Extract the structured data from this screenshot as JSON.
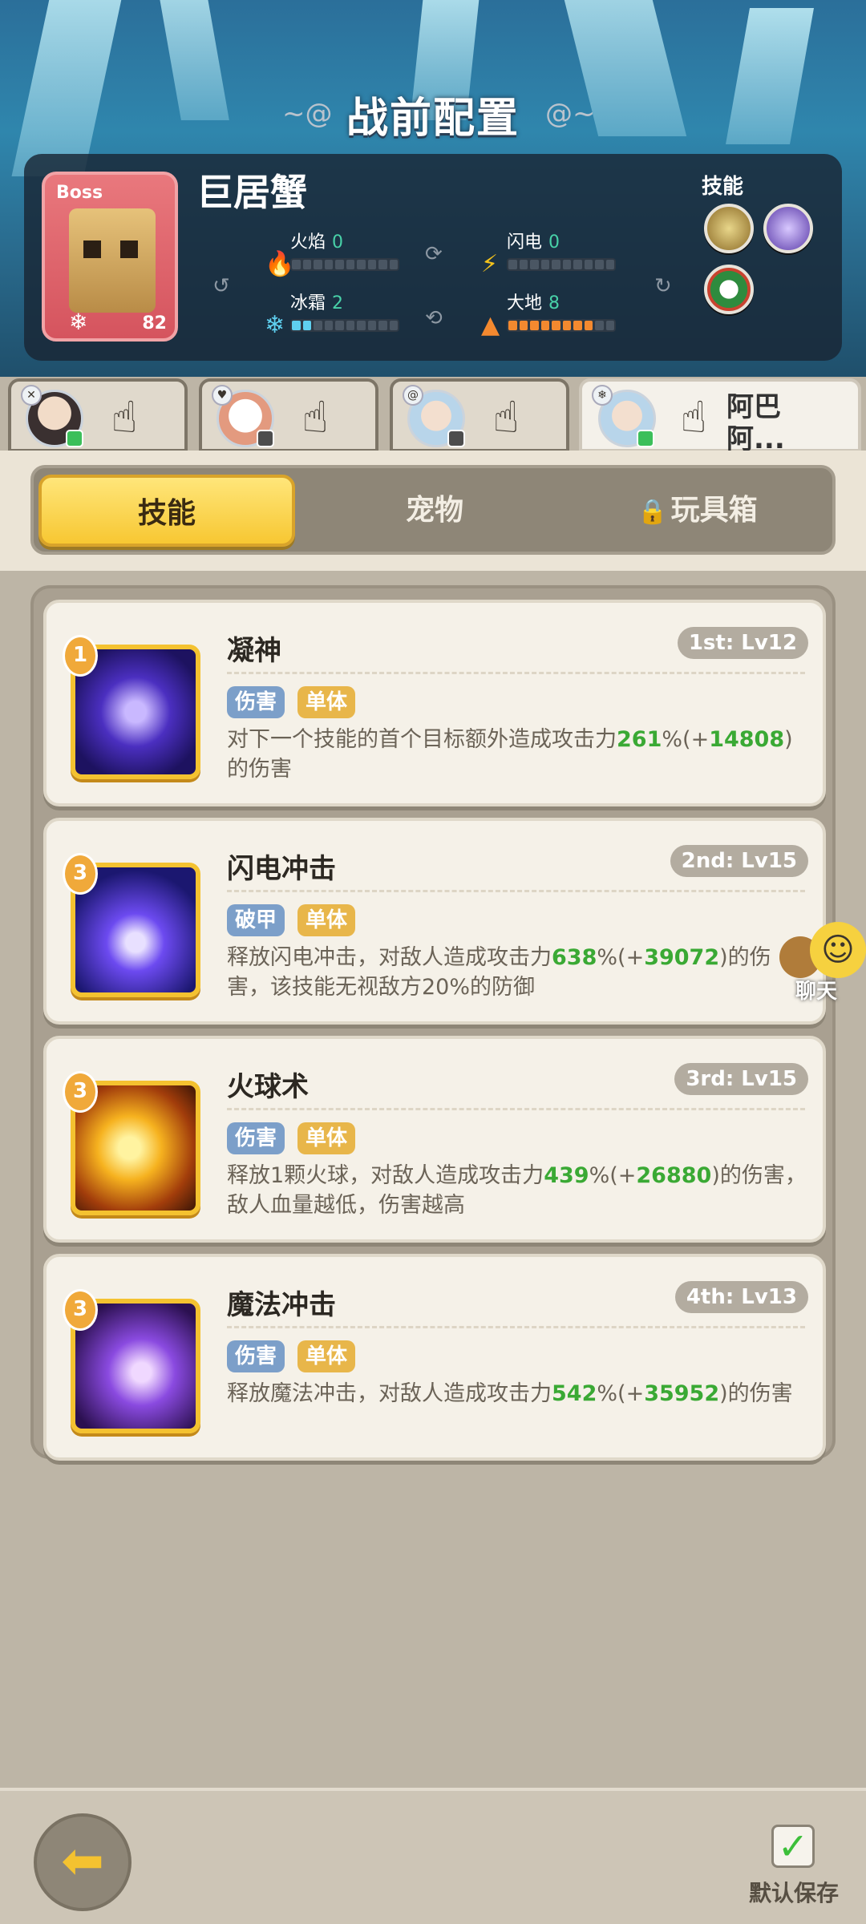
{
  "title": "战前配置",
  "boss": {
    "tag": "Boss",
    "name": "巨居蟹",
    "level": "82",
    "elements": [
      {
        "label": "火焰",
        "value": "0",
        "level": 0,
        "icon": "fire-icon",
        "color": "#e8432f"
      },
      {
        "label": "闪电",
        "value": "0",
        "level": 0,
        "icon": "lightning-icon",
        "color": "#f4c21c"
      },
      {
        "label": "冰霜",
        "value": "2",
        "level": 2,
        "icon": "snowflake-icon",
        "color": "#5fd0f0"
      },
      {
        "label": "大地",
        "value": "8",
        "level": 8,
        "icon": "mountain-icon",
        "color": "#f4892f"
      }
    ],
    "skills_label": "技能"
  },
  "team": [
    {
      "icon": "hero-avatar-dark-hair",
      "status": "green"
    },
    {
      "icon": "pet-avatar-white-bear",
      "status": "dark"
    },
    {
      "icon": "hero-avatar-blue-hair",
      "status": "dark"
    },
    {
      "icon": "hero-avatar-blue-hair-selected",
      "status": "green",
      "name": "阿巴阿..."
    }
  ],
  "tabs": {
    "skills": "技能",
    "pets": "宠物",
    "toybox": "玩具箱"
  },
  "skill_cards": [
    {
      "name": "凝神",
      "badge": "1",
      "slot": "1st: Lv12",
      "tags": [
        "伤害",
        "单体"
      ],
      "desc_pre": "对下一个技能的首个目标额外造成攻击力",
      "pct": "261",
      "pct_suffix": "%(+",
      "bonus": "14808",
      "desc_post": ")的伤害",
      "icon": "eye-swirl-skill-icon"
    },
    {
      "name": "闪电冲击",
      "badge": "3",
      "slot": "2nd: Lv15",
      "tags": [
        "破甲",
        "单体"
      ],
      "desc_pre": "释放闪电冲击，对敌人造成攻击力",
      "pct": "638",
      "pct_suffix": "%(+",
      "bonus": "39072",
      "desc_post": ")的伤害，该技能无视敌方20%的防御",
      "icon": "lightning-strike-skill-icon"
    },
    {
      "name": "火球术",
      "badge": "3",
      "slot": "3rd: Lv15",
      "tags": [
        "伤害",
        "单体"
      ],
      "desc_pre": "释放1颗火球，对敌人造成攻击力",
      "pct": "439",
      "pct_suffix": "%(+",
      "bonus": "26880",
      "desc_post": ")的伤害，敌人血量越低，伤害越高",
      "icon": "fireball-skill-icon"
    },
    {
      "name": "魔法冲击",
      "badge": "3",
      "slot": "4th: Lv13",
      "tags": [
        "伤害",
        "单体"
      ],
      "desc_pre": "释放魔法冲击，对敌人造成攻击力",
      "pct": "542",
      "pct_suffix": "%(+",
      "bonus": "35952",
      "desc_post": ")的伤害",
      "icon": "arcane-blast-skill-icon"
    }
  ],
  "chat_label": "聊天",
  "save_label": "默认保存",
  "colors": {
    "accent_gold": "#f7c732",
    "highlight_green": "#3aa934",
    "tag_blue": "#7c9fc9",
    "tag_gold": "#e8b64a"
  }
}
